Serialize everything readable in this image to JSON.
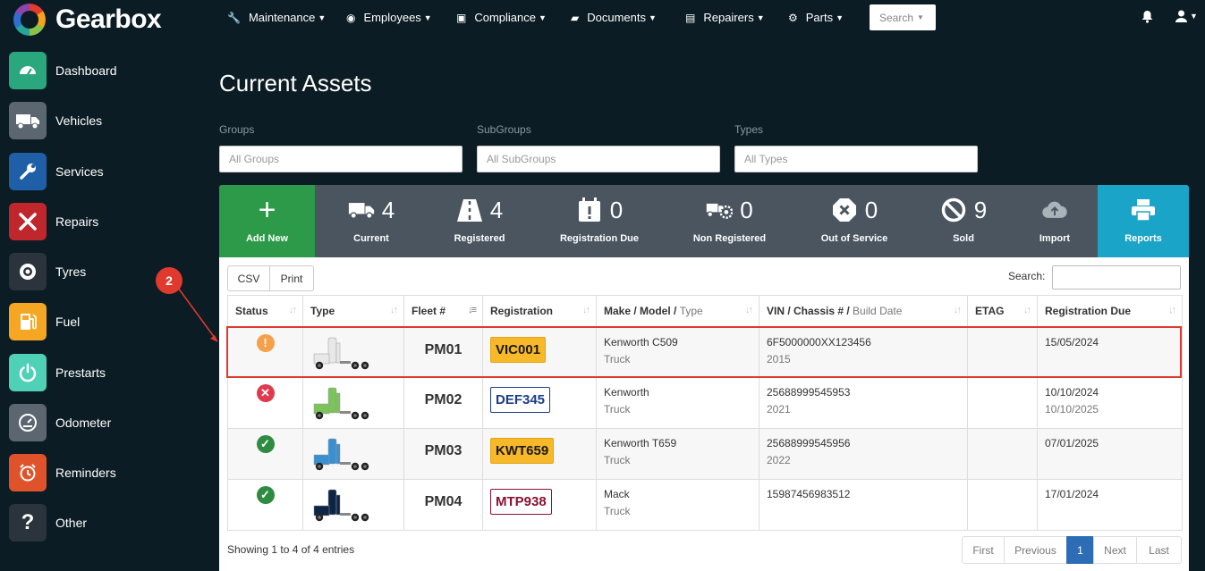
{
  "app": {
    "name": "Gearbox"
  },
  "sidebar": {
    "items": [
      {
        "label": "Dashboard",
        "icon": "dashboard-icon",
        "color": "#2aa77c"
      },
      {
        "label": "Vehicles",
        "icon": "truck-icon",
        "color": "#5b6670"
      },
      {
        "label": "Services",
        "icon": "wrench-icon",
        "color": "#1e5fa8"
      },
      {
        "label": "Repairs",
        "icon": "tools-icon",
        "color": "#c0272d"
      },
      {
        "label": "Tyres",
        "icon": "tyre-icon",
        "color": "#2b343c"
      },
      {
        "label": "Fuel",
        "icon": "fuel-pump-icon",
        "color": "#f5a623"
      },
      {
        "label": "Prestarts",
        "icon": "power-icon",
        "color": "#4fd1b8"
      },
      {
        "label": "Odometer",
        "icon": "odometer-icon",
        "color": "#5b6670"
      },
      {
        "label": "Reminders",
        "icon": "alarm-clock-icon",
        "color": "#e0532a"
      },
      {
        "label": "Other",
        "icon": "question-icon",
        "color": "#2b343c"
      }
    ]
  },
  "topnav": {
    "menus": [
      {
        "label": "Maintenance",
        "icon": "wrench-icon"
      },
      {
        "label": "Employees",
        "icon": "user-circle-icon"
      },
      {
        "label": "Compliance",
        "icon": "calendar-check-icon"
      },
      {
        "label": "Documents",
        "icon": "folder-open-icon"
      },
      {
        "label": "Repairers",
        "icon": "address-card-icon"
      },
      {
        "label": "Parts",
        "icon": "gear-icon"
      }
    ],
    "search_label": "Search"
  },
  "page": {
    "title": "Current Assets"
  },
  "filters": {
    "groups": {
      "label": "Groups",
      "value": "All Groups"
    },
    "subgroups": {
      "label": "SubGroups",
      "value": "All SubGroups"
    },
    "types": {
      "label": "Types",
      "value": "All Types"
    }
  },
  "stats": {
    "add_new": {
      "label": "Add New",
      "color": "#2c9a48"
    },
    "current": {
      "label": "Current",
      "count": "4"
    },
    "registered": {
      "label": "Registered",
      "count": "4"
    },
    "registration_due": {
      "label": "Registration Due",
      "count": "0"
    },
    "non_registered": {
      "label": "Non Registered",
      "count": "0"
    },
    "out_of_service": {
      "label": "Out of Service",
      "count": "0"
    },
    "sold": {
      "label": "Sold",
      "count": "9"
    },
    "import": {
      "label": "Import"
    },
    "reports": {
      "label": "Reports",
      "color": "#1aa5c8"
    }
  },
  "table": {
    "export_buttons": {
      "csv": "CSV",
      "print": "Print"
    },
    "search_label": "Search:",
    "headers": {
      "status": "Status",
      "type": "Type",
      "fleet": "Fleet #",
      "registration": "Registration",
      "make_model": "Make / Model / ",
      "make_model_sub": "Type",
      "vin": "VIN / Chassis # / ",
      "vin_sub": "Build Date",
      "etag": "ETAG",
      "registration_due": "Registration Due"
    },
    "rows": [
      {
        "status": "warning",
        "truck_color": "#e8e8e8",
        "fleet": "PM01",
        "rego": "VIC001",
        "plate_style": "yellow",
        "make": "Kenworth C509",
        "type": "Truck",
        "vin": "6F5000000XX123456",
        "build": "2015",
        "etag": "",
        "due": "15/05/2024",
        "due2": ""
      },
      {
        "status": "error",
        "truck_color": "#7cc35b",
        "fleet": "PM02",
        "rego": "DEF345",
        "plate_style": "blue",
        "make": "Kenworth",
        "type": "Truck",
        "vin": "25688999545953",
        "build": "2021",
        "etag": "",
        "due": "10/10/2024",
        "due2": "10/10/2025"
      },
      {
        "status": "ok",
        "truck_color": "#3a8fd0",
        "fleet": "PM03",
        "rego": "KWT659",
        "plate_style": "yellow",
        "make": "Kenworth T659",
        "type": "Truck",
        "vin": "25688999545956",
        "build": "2022",
        "etag": "",
        "due": "07/01/2025",
        "due2": ""
      },
      {
        "status": "ok",
        "truck_color": "#0d2545",
        "fleet": "PM04",
        "rego": "MTP938",
        "plate_style": "maroon",
        "make": "Mack",
        "type": "Truck",
        "vin": "15987456983512",
        "build": "",
        "etag": "",
        "due": "17/01/2024",
        "due2": ""
      }
    ],
    "footer": "Showing 1 to 4 of 4 entries",
    "pagination": {
      "first": "First",
      "previous": "Previous",
      "current": "1",
      "next": "Next",
      "last": "Last"
    }
  },
  "annotation": {
    "badge": "2",
    "color": "#e03a2e"
  }
}
